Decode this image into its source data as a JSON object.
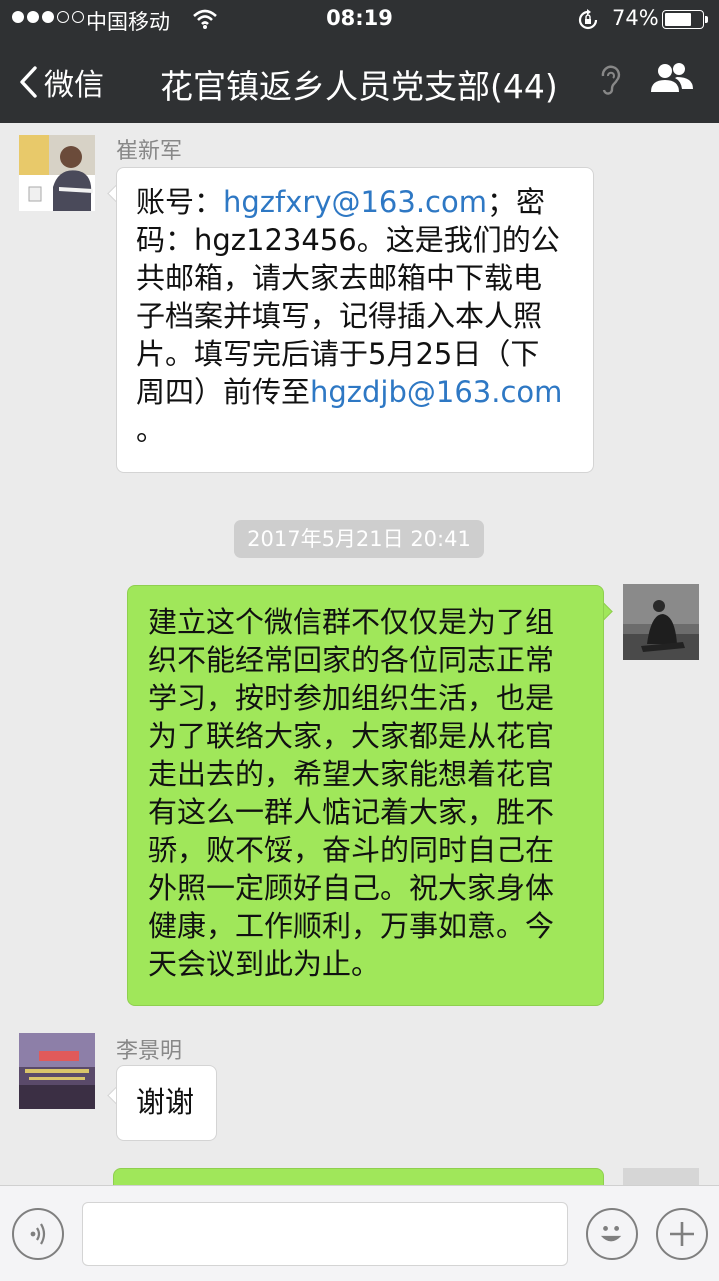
{
  "status_bar": {
    "carrier": "中国移动",
    "time": "08:19",
    "battery": "74%",
    "battery_level": 0.74
  },
  "nav": {
    "back_label": "微信",
    "title": "花官镇返乡人员党支部(44)"
  },
  "messages": [
    {
      "sender": "崔新军",
      "side": "left",
      "lines": [
        [
          "账号：",
          "hgzfxry@163.com",
          "；密"
        ],
        [
          "码：hgz123456。这是我们的公"
        ],
        [
          "共邮箱，请大家去邮箱中下载电"
        ],
        [
          "子档案并填写，记得插入本人照"
        ],
        [
          "片。填写完后请于5月25日（下"
        ],
        [
          "周四）前传至",
          "hgzdjb@163.com"
        ],
        [
          "。"
        ]
      ]
    },
    {
      "timestamp": "2017年5月21日 20:41"
    },
    {
      "side": "right",
      "lines": [
        "建立这个微信群不仅仅是为了组",
        "织不能经常回家的各位同志正常",
        "学习，按时参加组织生活，也是",
        "为了联络大家，大家都是从花官",
        "走出去的，希望大家能想着花官",
        "有这么一群人惦记着大家，胜不",
        "骄，败不馁，奋斗的同时自己在",
        "外照一定顾好自己。祝大家身体",
        "健康，工作顺利，万事如意。今",
        "天会议到此为止。"
      ]
    },
    {
      "sender": "李景明",
      "side": "left",
      "text": "谢谢"
    }
  ],
  "input": {
    "placeholder": ""
  },
  "icons": {
    "back": "chevron-left-icon",
    "ear": "ear-icon",
    "group": "group-members-icon",
    "voice": "voice-icon",
    "emoji": "emoji-icon",
    "plus": "plus-icon"
  },
  "colors": {
    "nav_bg": "#2f3133",
    "chat_bg": "#ebebeb",
    "bubble_self": "#a0e75a",
    "bubble_other": "#ffffff",
    "link": "#2e78c4"
  }
}
